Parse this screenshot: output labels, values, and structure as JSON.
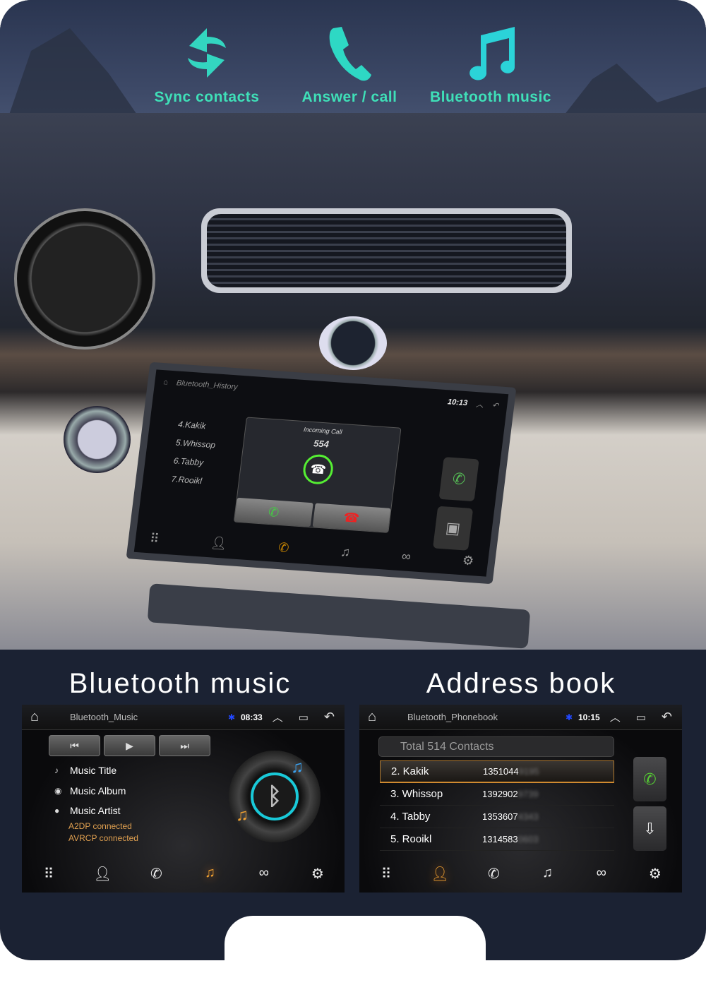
{
  "features": [
    {
      "label": "Sync contacts",
      "icon": "sync-icon"
    },
    {
      "label": "Answer / call",
      "icon": "phone-icon"
    },
    {
      "label": "Bluetooth music",
      "icon": "music-note-icon"
    }
  ],
  "accent_color": "#3fe0b8",
  "car_screen": {
    "title": "Bluetooth_History",
    "time": "10:13",
    "contacts": [
      "4.Kakik",
      "5.Whissop",
      "6.Tabby",
      "7.Rooikl"
    ],
    "incoming": {
      "label": "Incoming Call",
      "number": "554"
    }
  },
  "music_panel": {
    "heading": "Bluetooth music",
    "title": "Bluetooth_Music",
    "time": "08:33",
    "controls": [
      "previous",
      "play",
      "next"
    ],
    "info": [
      "Music Title",
      "Music Album",
      "Music Artist"
    ],
    "status": [
      "A2DP connected",
      "AVRCP connected"
    ],
    "active_tab": "music"
  },
  "phonebook_panel": {
    "heading": "Address book",
    "title": "Bluetooth_Phonebook",
    "time": "10:15",
    "search_placeholder": "Total 514 Contacts",
    "contacts": [
      {
        "name": "2. Kakik",
        "phone": "1351044",
        "hidden": "9195"
      },
      {
        "name": "3. Whissop",
        "phone": "1392902",
        "hidden": "9739"
      },
      {
        "name": "4. Tabby",
        "phone": "1353607",
        "hidden": "4343"
      },
      {
        "name": "5. Rooikl",
        "phone": "1314583",
        "hidden": "0603"
      }
    ],
    "active_tab": "contacts"
  }
}
